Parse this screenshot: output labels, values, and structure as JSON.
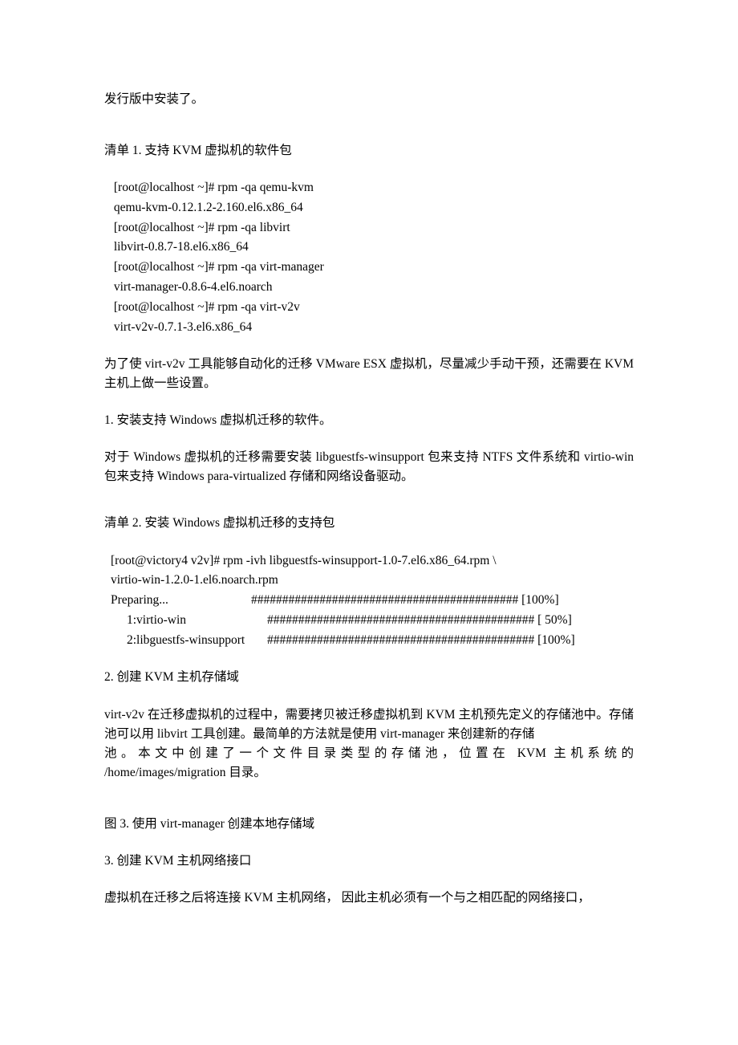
{
  "intro_tail": "发行版中安装了。",
  "listing1_title": "清单 1. 支持 KVM 虚拟机的软件包",
  "code1": " [root@localhost ~]# rpm -qa qemu-kvm \n qemu-kvm-0.12.1.2-2.160.el6.x86_64 \n [root@localhost ~]# rpm -qa libvirt \n libvirt-0.8.7-18.el6.x86_64 \n [root@localhost ~]# rpm -qa virt-manager \n virt-manager-0.8.6-4.el6.noarch \n [root@localhost ~]# rpm -qa virt-v2v \n virt-v2v-0.7.1-3.el6.x86_64",
  "para_after_code1": "为了使 virt-v2v 工具能够自动化的迁移 VMware ESX 虚拟机，尽量减少手动干预，还需要在 KVM 主机上做一些设置。",
  "step1_title": "1. 安装支持 Windows 虚拟机迁移的软件。",
  "step1_body": "对于 Windows 虚拟机的迁移需要安装 libguestfs-winsupport 包来支持 NTFS 文件系统和 virtio-win 包来支持 Windows para-virtualized 存储和网络设备驱动。",
  "listing2_title": "清单 2. 安装 Windows 虚拟机迁移的支持包",
  "code2_cmd1": " [root@victory4 v2v]# rpm -ivh libguestfs-winsupport-1.0-7.el6.x86_64.rpm    \\",
  "code2_cmd2": " virtio-win-1.2.0-1.el6.noarch.rpm",
  "rpm_rows": [
    {
      "label": " Preparing...",
      "indent": false,
      "bar": "########################################### [100%]"
    },
    {
      "label": "1:virtio-win",
      "indent": true,
      "bar": "########################################### [ 50%]"
    },
    {
      "label": "2:libguestfs-winsupport",
      "indent": true,
      "bar": "########################################### [100%]"
    }
  ],
  "step2_title": "2. 创建 KVM 主机存储域",
  "step2_body_a": "virt-v2v 在迁移虚拟机的过程中，需要拷贝被迁移虚拟机到 KVM 主机预先定义的存储池中。存储池可以用 libvirt 工具创建。最简单的方法就是使用 virt-manager 来创建新的存储",
  "step2_body_b": "池。本文中创建了一个文件目录类型的存储池，位置在 KVM 主机系统的",
  "step2_body_c": "/home/images/migration 目录。",
  "fig3_title": "图 3. 使用 virt-manager 创建本地存储域",
  "step3_title": "3. 创建 KVM 主机网络接口",
  "step3_body": "虚拟机在迁移之后将连接 KVM 主机网络， 因此主机必须有一个与之相匹配的网络接口，"
}
